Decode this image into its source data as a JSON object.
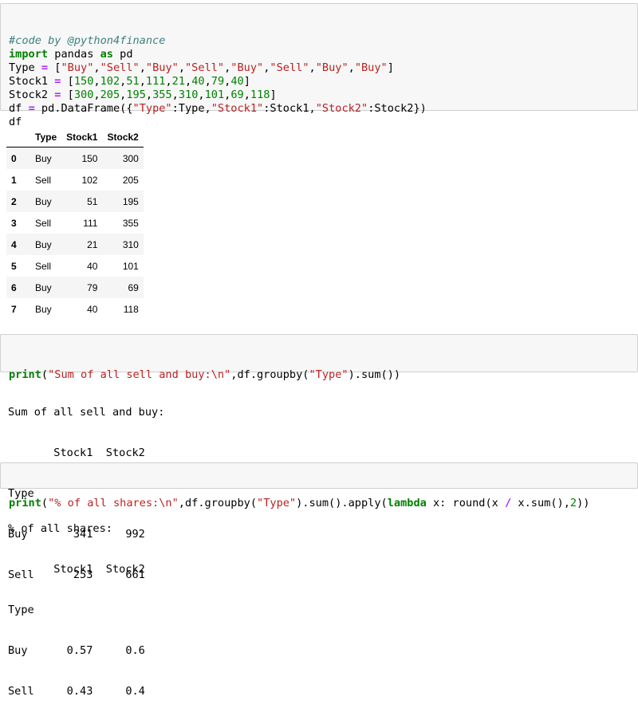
{
  "cell1": {
    "lines": [
      [
        [
          "cm",
          "#code by @python4finance"
        ]
      ],
      [
        [
          "kw",
          "import"
        ],
        [
          "txt",
          " pandas "
        ],
        [
          "kw",
          "as"
        ],
        [
          "txt",
          " pd"
        ]
      ],
      [
        [
          "txt",
          "Type "
        ],
        [
          "op",
          "="
        ],
        [
          "txt",
          " ["
        ],
        [
          "str",
          "\"Buy\""
        ],
        [
          "txt",
          ","
        ],
        [
          "str",
          "\"Sell\""
        ],
        [
          "txt",
          ","
        ],
        [
          "str",
          "\"Buy\""
        ],
        [
          "txt",
          ","
        ],
        [
          "str",
          "\"Sell\""
        ],
        [
          "txt",
          ","
        ],
        [
          "str",
          "\"Buy\""
        ],
        [
          "txt",
          ","
        ],
        [
          "str",
          "\"Sell\""
        ],
        [
          "txt",
          ","
        ],
        [
          "str",
          "\"Buy\""
        ],
        [
          "txt",
          ","
        ],
        [
          "str",
          "\"Buy\""
        ],
        [
          "txt",
          "]"
        ]
      ],
      [
        [
          "txt",
          "Stock1 "
        ],
        [
          "op",
          "="
        ],
        [
          "txt",
          " ["
        ],
        [
          "num",
          "150"
        ],
        [
          "txt",
          ","
        ],
        [
          "num",
          "102"
        ],
        [
          "txt",
          ","
        ],
        [
          "num",
          "51"
        ],
        [
          "txt",
          ","
        ],
        [
          "num",
          "111"
        ],
        [
          "txt",
          ","
        ],
        [
          "num",
          "21"
        ],
        [
          "txt",
          ","
        ],
        [
          "num",
          "40"
        ],
        [
          "txt",
          ","
        ],
        [
          "num",
          "79"
        ],
        [
          "txt",
          ","
        ],
        [
          "num",
          "40"
        ],
        [
          "txt",
          "]"
        ]
      ],
      [
        [
          "txt",
          "Stock2 "
        ],
        [
          "op",
          "="
        ],
        [
          "txt",
          " ["
        ],
        [
          "num",
          "300"
        ],
        [
          "txt",
          ","
        ],
        [
          "num",
          "205"
        ],
        [
          "txt",
          ","
        ],
        [
          "num",
          "195"
        ],
        [
          "txt",
          ","
        ],
        [
          "num",
          "355"
        ],
        [
          "txt",
          ","
        ],
        [
          "num",
          "310"
        ],
        [
          "txt",
          ","
        ],
        [
          "num",
          "101"
        ],
        [
          "txt",
          ","
        ],
        [
          "num",
          "69"
        ],
        [
          "txt",
          ","
        ],
        [
          "num",
          "118"
        ],
        [
          "txt",
          "]"
        ]
      ],
      [
        [
          "txt",
          "df "
        ],
        [
          "op",
          "="
        ],
        [
          "txt",
          " pd.DataFrame({"
        ],
        [
          "str",
          "\"Type\""
        ],
        [
          "txt",
          ":Type,"
        ],
        [
          "str",
          "\"Stock1\""
        ],
        [
          "txt",
          ":Stock1,"
        ],
        [
          "str",
          "\"Stock2\""
        ],
        [
          "txt",
          ":Stock2})"
        ]
      ],
      [
        [
          "txt",
          "df"
        ]
      ]
    ]
  },
  "dataframe": {
    "columns": [
      "",
      "Type",
      "Stock1",
      "Stock2"
    ],
    "rows": [
      {
        "index": "0",
        "type": "Buy",
        "stock1": "150",
        "stock2": "300"
      },
      {
        "index": "1",
        "type": "Sell",
        "stock1": "102",
        "stock2": "205"
      },
      {
        "index": "2",
        "type": "Buy",
        "stock1": "51",
        "stock2": "195"
      },
      {
        "index": "3",
        "type": "Sell",
        "stock1": "111",
        "stock2": "355"
      },
      {
        "index": "4",
        "type": "Buy",
        "stock1": "21",
        "stock2": "310"
      },
      {
        "index": "5",
        "type": "Sell",
        "stock1": "40",
        "stock2": "101"
      },
      {
        "index": "6",
        "type": "Buy",
        "stock1": "79",
        "stock2": "69"
      },
      {
        "index": "7",
        "type": "Buy",
        "stock1": "40",
        "stock2": "118"
      }
    ]
  },
  "cell2": {
    "lines": [
      [
        [
          "kw",
          "print"
        ],
        [
          "txt",
          "("
        ],
        [
          "str",
          "\"Sum of all sell and buy:\\n\""
        ],
        [
          "txt",
          ",df.groupby("
        ],
        [
          "str",
          "\"Type\""
        ],
        [
          "txt",
          ").sum())"
        ]
      ]
    ]
  },
  "output2": {
    "lines": [
      "Sum of all sell and buy:",
      "       Stock1  Stock2",
      "Type",
      "Buy       341     992",
      "Sell      253     661"
    ]
  },
  "cell3": {
    "lines": [
      [
        [
          "kw",
          "print"
        ],
        [
          "txt",
          "("
        ],
        [
          "str",
          "\"% of all shares:\\n\""
        ],
        [
          "txt",
          ",df.groupby("
        ],
        [
          "str",
          "\"Type\""
        ],
        [
          "txt",
          ").sum().apply("
        ],
        [
          "kw",
          "lambda"
        ],
        [
          "txt",
          " x: round(x "
        ],
        [
          "op",
          "/"
        ],
        [
          "txt",
          " x.sum(),"
        ],
        [
          "num",
          "2"
        ],
        [
          "txt",
          "))"
        ]
      ]
    ]
  },
  "output3": {
    "lines": [
      "% of all shares:",
      "       Stock1  Stock2",
      "Type",
      "Buy      0.57     0.6",
      "Sell     0.43     0.4"
    ]
  },
  "colors": {
    "comment": "#408080",
    "keyword": "#008000",
    "string": "#ba2121",
    "number": "#008000",
    "operator": "#aa22ff",
    "cell_bg": "#f7f7f7",
    "cell_border": "#cfcfcf"
  }
}
